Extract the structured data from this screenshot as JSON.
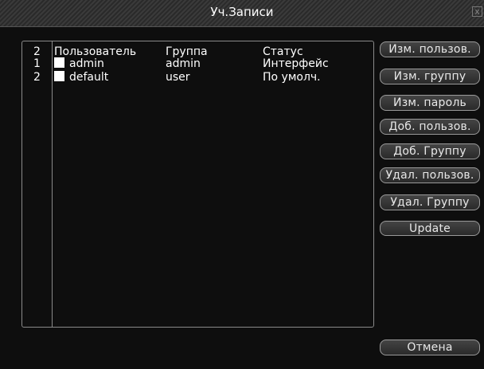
{
  "window": {
    "title": "Уч.Записи",
    "close_glyph": "x"
  },
  "table": {
    "count": "2",
    "headers": {
      "user": "Пользователь",
      "group": "Группа",
      "status": "Статус"
    },
    "rows": [
      {
        "index": "1",
        "user": "admin",
        "group": "admin",
        "status": "Интерфейс"
      },
      {
        "index": "2",
        "user": "default",
        "group": "user",
        "status": "По умолч."
      }
    ]
  },
  "buttons": {
    "edit_user": "Изм. пользов.",
    "edit_group": "Изм. группу",
    "edit_password": "Изм. пароль",
    "add_user": "Доб. пользов.",
    "add_group": "Доб. Группу",
    "delete_user": "Удал. пользов.",
    "delete_group": "Удал. Группу",
    "update": "Update",
    "cancel": "Отмена"
  }
}
